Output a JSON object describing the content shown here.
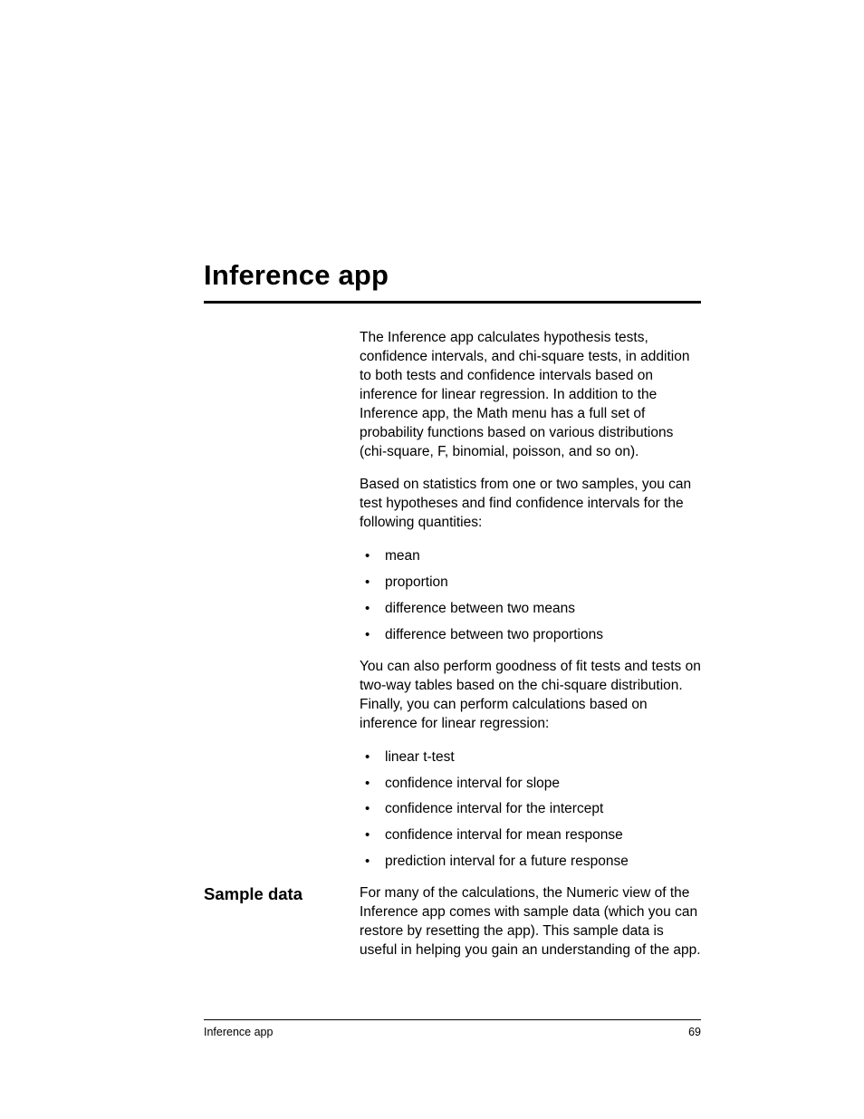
{
  "title": "Inference app",
  "intro": "The Inference app calculates hypothesis tests, confidence intervals, and chi-square tests, in addition to both tests and confidence intervals based on inference for linear regression. In addition to the Inference app, the Math menu has a full set of probability functions based on various distributions (chi-square, F, binomial, poisson, and so on).",
  "para2": "Based on statistics from one or two samples, you can test hypotheses and find confidence intervals for the following quantities:",
  "list1": [
    "mean",
    "proportion",
    "difference between two means",
    "difference between two proportions"
  ],
  "para3": "You can also perform goodness of fit tests and tests on two-way tables based on the chi-square distribution. Finally, you can perform calculations based on inference for linear regression:",
  "list2": [
    "linear t-test",
    "confidence interval for slope",
    "confidence interval for the intercept",
    "confidence interval for mean response",
    "prediction interval for a future response"
  ],
  "sampleHeading": "Sample data",
  "samplePara": "For many of the calculations, the Numeric view of the Inference app comes with sample data (which you can restore by resetting the app). This sample data is useful in helping you gain an understanding of the app.",
  "footerLeft": "Inference app",
  "footerRight": "69"
}
